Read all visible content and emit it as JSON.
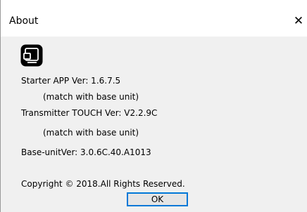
{
  "window": {
    "title": "About",
    "close_glyph": "✕"
  },
  "icon": {
    "name": "app-icon",
    "color": "#000000"
  },
  "info": {
    "starter_app": "Starter APP Ver: 1.6.7.5",
    "starter_note": "(match with base unit)",
    "transmitter": "Transmitter TOUCH Ver: V2.2.9C",
    "transmitter_note": "(match with base unit)",
    "base_unit": "Base-unitVer: 3.0.6C.40.A1013",
    "copyright": "Copyright © 2018.All Rights Reserved."
  },
  "buttons": {
    "ok_label": "OK"
  },
  "colors": {
    "client_background": "#f0f0f0",
    "title_background": "#ffffff",
    "focus_border": "#0078d7"
  }
}
